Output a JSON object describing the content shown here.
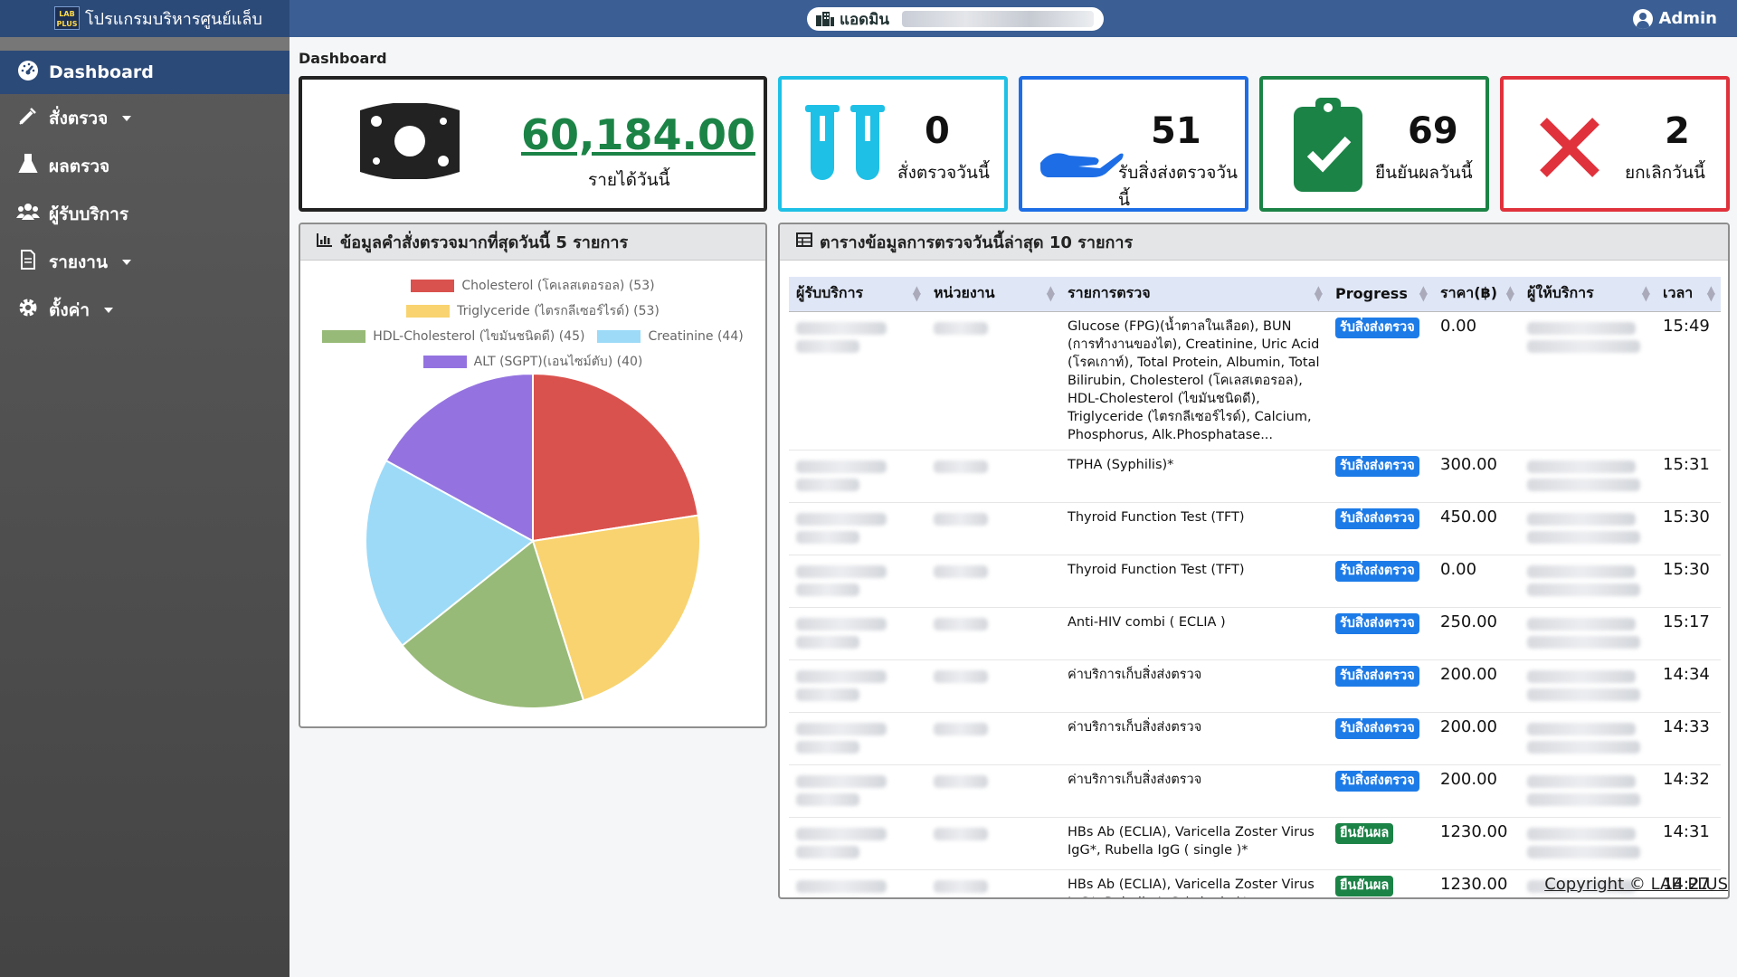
{
  "app": {
    "title": "โปรแกรมบริหารศูนย์แล็บ",
    "logo_text": "LAB PLUS"
  },
  "header": {
    "center_label": "แอดมิน",
    "user": "Admin"
  },
  "sidebar": {
    "items": [
      {
        "label": "Dashboard",
        "icon": "dashboard-icon",
        "active": true
      },
      {
        "label": "สั่งตรวจ",
        "icon": "syringe-icon",
        "dropdown": true
      },
      {
        "label": "ผลตรวจ",
        "icon": "flask-icon"
      },
      {
        "label": "ผู้รับบริการ",
        "icon": "users-icon"
      },
      {
        "label": "รายงาน",
        "icon": "document-icon",
        "dropdown": true
      },
      {
        "label": "ตั้งค่า",
        "icon": "gear-icon",
        "dropdown": true
      }
    ]
  },
  "breadcrumb": "Dashboard",
  "cards": {
    "revenue": {
      "value": "60,184.00",
      "label": "รายได้วันนี้",
      "color": "#222222"
    },
    "orders": {
      "value": "0",
      "label": "สั่งตรวจวันนี้",
      "color": "#1ec0e6"
    },
    "received": {
      "value": "51",
      "label": "รับสิ่งส่งตรวจวันนี้",
      "color": "#1d6ee6"
    },
    "confirmed": {
      "value": "69",
      "label": "ยืนยันผลวันนี้",
      "color": "#1b8346"
    },
    "cancelled": {
      "value": "2",
      "label": "ยกเลิกวันนี้",
      "color": "#e0323c"
    }
  },
  "chart_panel": {
    "title": "ข้อมูลคำสั่งตรวจมากที่สุดวันนี้ 5 รายการ"
  },
  "chart_data": {
    "type": "pie",
    "categories": [
      "Cholesterol (โคเลสเตอรอล)",
      "Triglyceride (ไตรกลีเซอร์ไรด์)",
      "HDL-Cholesterol (ไขมันชนิดดี)",
      "Creatinine",
      "ALT (SGPT)(เอนไซม์ตับ)"
    ],
    "values": [
      53,
      53,
      45,
      44,
      40
    ],
    "legend_labels": [
      "Cholesterol (โคเลสเตอรอล) (53)",
      "Triglyceride (ไตรกลีเซอร์ไรด์) (53)",
      "HDL-Cholesterol (ไขมันชนิดดี) (45)",
      "Creatinine (44)",
      "ALT (SGPT)(เอนไซม์ตับ) (40)"
    ],
    "colors": [
      "#da524e",
      "#f8d36f",
      "#98ba78",
      "#9cdaf8",
      "#9473e0"
    ],
    "legend_position": "top"
  },
  "table_panel": {
    "title": "ตารางข้อมูลการตรวจวันนี้ล่าสุด 10 รายการ",
    "columns": [
      "ผู้รับบริการ",
      "หน่วยงาน",
      "รายการตรวจ",
      "Progress",
      "ราคา(฿)",
      "ผู้ให้บริการ",
      "เวลา"
    ],
    "rows": [
      {
        "test": "Glucose (FPG)(น้ำตาลในเลือด), BUN (การทำงานของไต), Creatinine, Uric Acid (โรคเกาท์), Total Protein, Albumin, Total Bilirubin, Cholesterol (โคเลสเตอรอล), HDL-Cholesterol (ไขมันชนิดดี), Triglyceride (ไตรกลีเซอร์ไรด์), Calcium, Phosphorus, Alk.Phosphatase...",
        "progress": "รับสิ่งส่งตรวจ",
        "status": "blue",
        "price": "0.00",
        "time": "15:49"
      },
      {
        "test": "TPHA (Syphilis)*",
        "progress": "รับสิ่งส่งตรวจ",
        "status": "blue",
        "price": "300.00",
        "time": "15:31"
      },
      {
        "test": "Thyroid Function Test (TFT)",
        "progress": "รับสิ่งส่งตรวจ",
        "status": "blue",
        "price": "450.00",
        "time": "15:30"
      },
      {
        "test": "Thyroid Function Test (TFT)",
        "progress": "รับสิ่งส่งตรวจ",
        "status": "blue",
        "price": "0.00",
        "time": "15:30"
      },
      {
        "test": "Anti-HIV combi ( ECLIA )",
        "progress": "รับสิ่งส่งตรวจ",
        "status": "blue",
        "price": "250.00",
        "time": "15:17"
      },
      {
        "test": "ค่าบริการเก็บสิ่งส่งตรวจ",
        "progress": "รับสิ่งส่งตรวจ",
        "status": "blue",
        "price": "200.00",
        "time": "14:34"
      },
      {
        "test": "ค่าบริการเก็บสิ่งส่งตรวจ",
        "progress": "รับสิ่งส่งตรวจ",
        "status": "blue",
        "price": "200.00",
        "time": "14:33"
      },
      {
        "test": "ค่าบริการเก็บสิ่งส่งตรวจ",
        "progress": "รับสิ่งส่งตรวจ",
        "status": "blue",
        "price": "200.00",
        "time": "14:32"
      },
      {
        "test": "HBs Ab (ECLIA), Varicella Zoster Virus IgG*, Rubella IgG ( single )*",
        "progress": "ยืนยันผล",
        "status": "green",
        "price": "1230.00",
        "time": "14:31"
      },
      {
        "test": "HBs Ab (ECLIA), Varicella Zoster Virus IgG*, Rubella IgG ( single )*",
        "progress": "ยืนยันผล",
        "status": "green",
        "price": "1230.00",
        "time": "14:27"
      }
    ]
  },
  "footer": {
    "copyright": "Copyright © LAB PLUS"
  }
}
